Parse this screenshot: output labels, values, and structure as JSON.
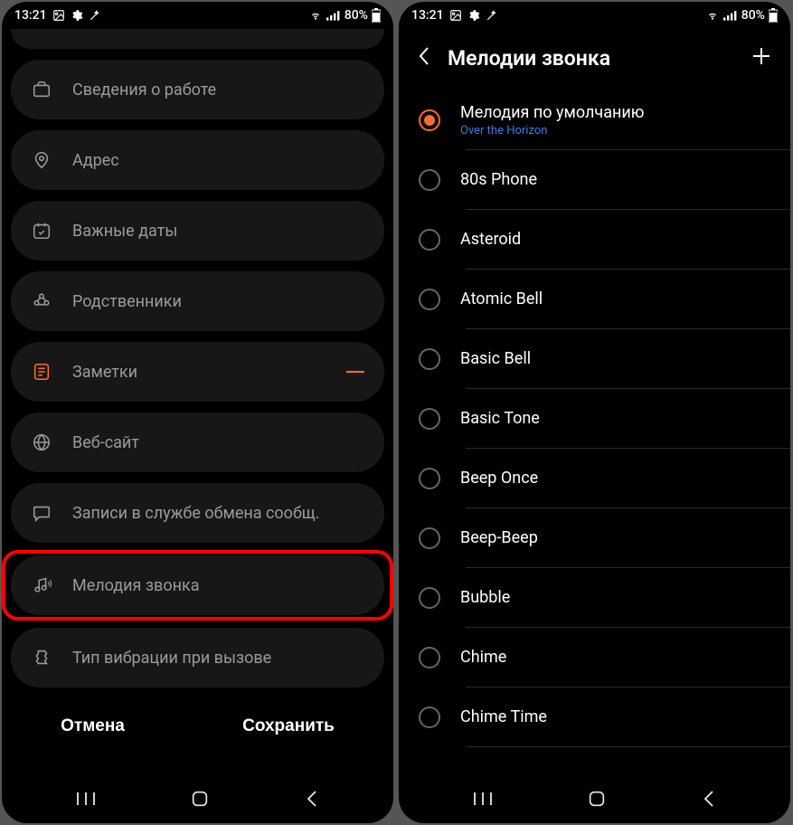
{
  "status": {
    "time": "13:21",
    "battery": "80%"
  },
  "left": {
    "rows": {
      "work": "Сведения о работе",
      "address": "Адрес",
      "dates": "Важные даты",
      "relatives": "Родственники",
      "notes": "Заметки",
      "website": "Веб-сайт",
      "messaging": "Записи в службе обмена сообщ.",
      "ringtone": "Мелодия звонка",
      "vibration": "Тип вибрации при вызове"
    },
    "actions": {
      "cancel": "Отмена",
      "save": "Сохранить"
    }
  },
  "right": {
    "title": "Мелодии звонка",
    "default": {
      "name": "Мелодия по умолчанию",
      "sub": "Over the Horizon"
    },
    "items": [
      "80s Phone",
      "Asteroid",
      "Atomic Bell",
      "Basic Bell",
      "Basic Tone",
      "Beep Once",
      "Beep-Beep",
      "Bubble",
      "Chime",
      "Chime Time"
    ]
  }
}
